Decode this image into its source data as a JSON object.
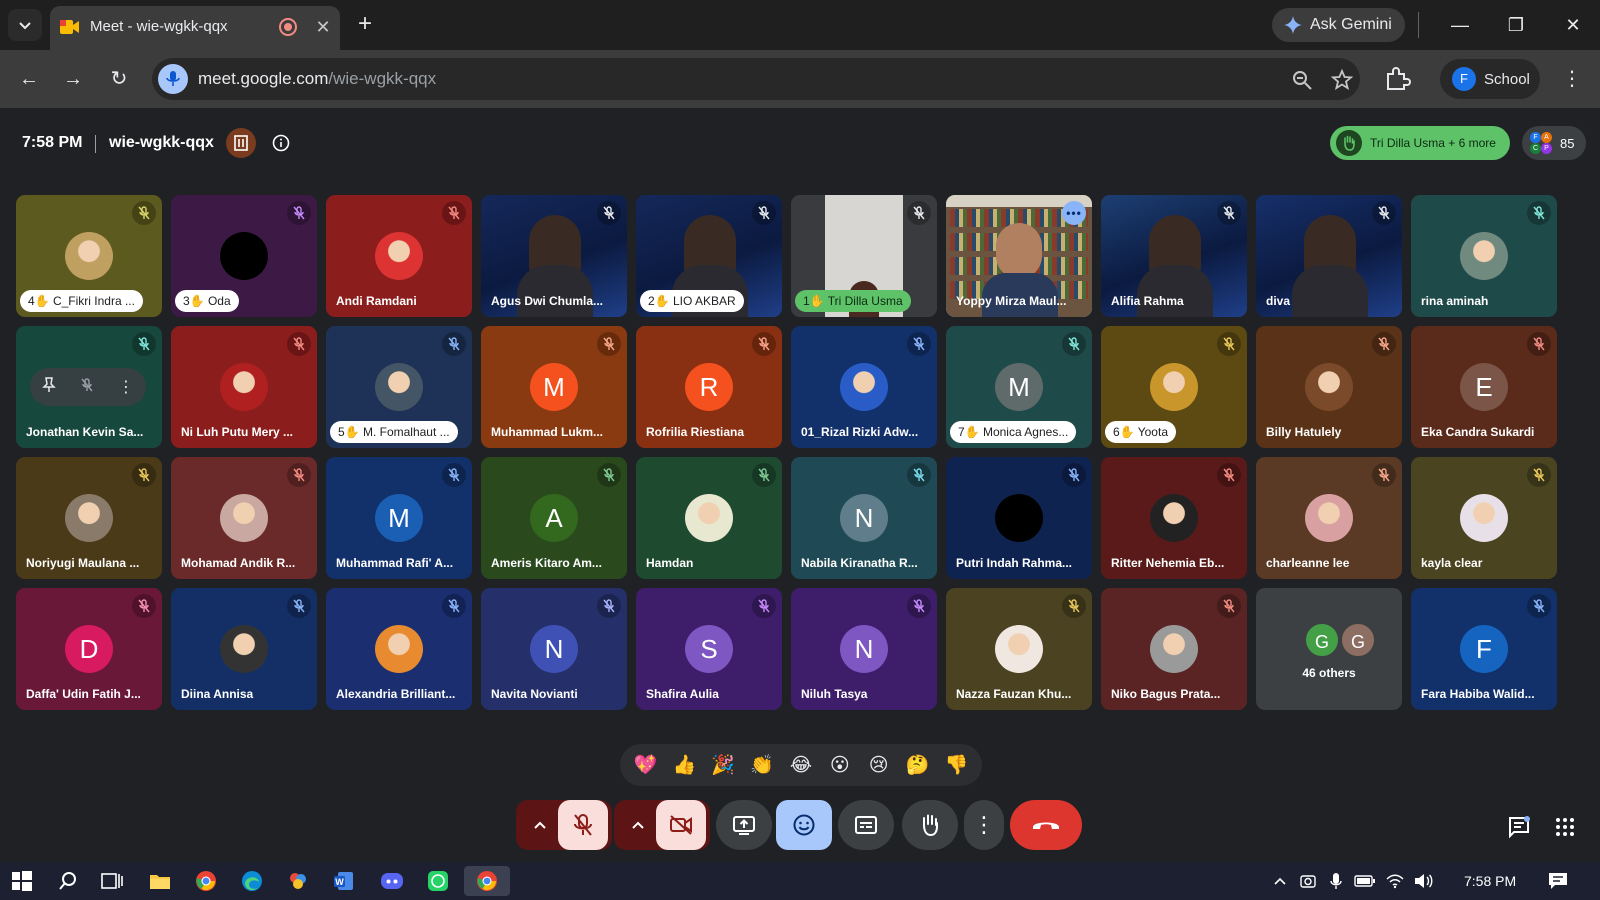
{
  "browser": {
    "tab_title": "Meet - wie-wgkk-qqx",
    "gemini_label": "Ask Gemini",
    "url_domain": "meet.google.com",
    "url_path": "/wie-wgkk-qqx",
    "profile_initial": "F",
    "profile_label": "School"
  },
  "meet": {
    "time": "7:58 PM",
    "meeting_code": "wie-wgkk-qqx",
    "hands_raised": "Tri Dilla Usma + 6 more",
    "participant_count": "85",
    "people_initials": [
      "F",
      "A",
      "C",
      "P"
    ]
  },
  "tiles": [
    {
      "name": "C_Fikri Indra ...",
      "hand": "4",
      "bg": "#5c5a1e",
      "type": "photo",
      "avatar_color": "#c0a060",
      "mute_color": "#d9d56b"
    },
    {
      "name": "Oda",
      "hand": "3",
      "bg": "#3d1a46",
      "type": "black",
      "mute_color": "#c58af9"
    },
    {
      "name": "Andi Ramdani",
      "bg": "#8c1d1d",
      "type": "photo",
      "avatar_color": "#d33",
      "mute_color": "#f28b82"
    },
    {
      "name": "Agus Dwi Chumla...",
      "bg": "#15285a",
      "type": "video",
      "mute_color": "#e8eaed"
    },
    {
      "name": "LIO AKBAR",
      "hand": "2",
      "bg": "#15285a",
      "type": "video",
      "mute_color": "#e8eaed"
    },
    {
      "name": "Tri Dilla Usma",
      "hand": "1",
      "green": true,
      "bg": "#3a3b3e",
      "type": "video-light",
      "mute_color": "#e8eaed"
    },
    {
      "name": "Yoppy Mirza Maul...",
      "bg": "#4a3826",
      "type": "video-shelf",
      "active": true,
      "more": true
    },
    {
      "name": "Alifia Rahma",
      "bg": "#1d3f73",
      "type": "video",
      "mute_color": "#e8eaed"
    },
    {
      "name": "diva",
      "bg": "#17306a",
      "type": "video",
      "mute_color": "#e8eaed"
    },
    {
      "name": "rina aminah",
      "bg": "#1f4a4a",
      "type": "photo",
      "avatar_color": "#708a80",
      "mute_color": "#81e6d9"
    },
    {
      "name": "Jonathan Kevin Sa...",
      "bg": "#17483d",
      "type": "hover",
      "mute_color": "#81e6d9"
    },
    {
      "name": "Ni Luh Putu Mery ...",
      "bg": "#8c1d1d",
      "type": "photo",
      "avatar_color": "#b02020",
      "mute_color": "#f28b82"
    },
    {
      "name": "M. Fomalhaut ...",
      "hand": "5",
      "bg": "#1d3256",
      "type": "photo",
      "avatar_color": "#445566",
      "mute_color": "#8ab4f8"
    },
    {
      "name": "Muhammad Lukm...",
      "bg": "#8a3a10",
      "type": "letter",
      "letter": "M",
      "avatar_color": "#f4511e",
      "mute_color": "#f6a68a"
    },
    {
      "name": "Rofrilia Riestiana",
      "bg": "#8a3012",
      "type": "letter",
      "letter": "R",
      "avatar_color": "#f4511e",
      "mute_color": "#f6a68a"
    },
    {
      "name": "01_Rizal Rizki Adw...",
      "bg": "#12306a",
      "type": "photo",
      "avatar_color": "#2a5cc8",
      "mute_color": "#8ab4f8"
    },
    {
      "name": "Monica Agnes...",
      "hand": "7",
      "bg": "#1f4a4a",
      "type": "letter",
      "letter": "M",
      "avatar_color": "#5f6b6b",
      "mute_color": "#81e6d9"
    },
    {
      "name": "Yoota",
      "hand": "6",
      "bg": "#5c4a12",
      "type": "photo",
      "avatar_color": "#c8962a",
      "mute_color": "#e8c85a"
    },
    {
      "name": "Billy Hatulely",
      "bg": "#5a3218",
      "type": "photo",
      "avatar_color": "#7a4a2a",
      "mute_color": "#f6a68a"
    },
    {
      "name": "Eka Candra Sukardi",
      "bg": "#5a2a1a",
      "type": "letter",
      "letter": "E",
      "avatar_color": "#7a5548",
      "mute_color": "#f28b82"
    },
    {
      "name": "Noriyugi Maulana ...",
      "bg": "#4a3a18",
      "type": "photo",
      "avatar_color": "#8a7a6a",
      "mute_color": "#e8c85a"
    },
    {
      "name": "Mohamad Andik R...",
      "bg": "#6b2a2a",
      "type": "photo",
      "avatar_color": "#c8a8a0",
      "mute_color": "#f28b82"
    },
    {
      "name": "Muhammad Rafi' A...",
      "bg": "#12306a",
      "type": "letter",
      "letter": "M",
      "avatar_color": "#1a5fb4",
      "mute_color": "#8ab4f8"
    },
    {
      "name": "Ameris Kitaro Am...",
      "bg": "#2a4a1e",
      "type": "letter",
      "letter": "A",
      "avatar_color": "#33691e",
      "mute_color": "#81c995"
    },
    {
      "name": "Hamdan",
      "bg": "#1e4a30",
      "type": "photo",
      "avatar_color": "#e8e8d0",
      "mute_color": "#81c995"
    },
    {
      "name": "Nabila Kiranatha R...",
      "bg": "#1f4a55",
      "type": "letter",
      "letter": "N",
      "avatar_color": "#607d8b",
      "mute_color": "#78d9ec"
    },
    {
      "name": "Putri Indah Rahma...",
      "bg": "#0f2350",
      "type": "black",
      "mute_color": "#8ab4f8"
    },
    {
      "name": "Ritter Nehemia Eb...",
      "bg": "#5a1a1a",
      "type": "photo",
      "avatar_color": "#222",
      "mute_color": "#f28b82"
    },
    {
      "name": "charleanne lee",
      "bg": "#5a3a24",
      "type": "photo",
      "avatar_color": "#d8a0a0",
      "mute_color": "#f6a68a"
    },
    {
      "name": "kayla clear",
      "bg": "#4a4420",
      "type": "photo",
      "avatar_color": "#e8e0e8",
      "mute_color": "#e8c85a"
    },
    {
      "name": "Daffa' Udin Fatih J...",
      "bg": "#6a1838",
      "type": "letter",
      "letter": "D",
      "avatar_color": "#d81b60",
      "mute_color": "#f48fb1"
    },
    {
      "name": "Diina Annisa",
      "bg": "#142f66",
      "type": "photo",
      "avatar_color": "#333",
      "mute_color": "#8ab4f8"
    },
    {
      "name": "Alexandria Brilliant...",
      "bg": "#1a2e70",
      "type": "photo",
      "avatar_color": "#e88a30",
      "mute_color": "#8ab4f8"
    },
    {
      "name": "Navita Novianti",
      "bg": "#25306a",
      "type": "letter",
      "letter": "N",
      "avatar_color": "#3f51b5",
      "mute_color": "#aab4f8"
    },
    {
      "name": "Shafira Aulia",
      "bg": "#3e1e6a",
      "type": "letter",
      "letter": "S",
      "avatar_color": "#7e57c2",
      "mute_color": "#c58af9"
    },
    {
      "name": "Niluh Tasya",
      "bg": "#3e1e6a",
      "type": "letter",
      "letter": "N",
      "avatar_color": "#7e57c2",
      "mute_color": "#c58af9"
    },
    {
      "name": "Nazza Fauzan Khu...",
      "bg": "#4a4220",
      "type": "photo",
      "avatar_color": "#f0e8e0",
      "mute_color": "#e8c85a"
    },
    {
      "name": "Niko Bagus Prata...",
      "bg": "#5a2424",
      "type": "photo",
      "avatar_color": "#9a9a9a",
      "mute_color": "#f28b82"
    },
    {
      "name": "46 others",
      "bg": "#3c4043",
      "type": "others",
      "letters": [
        "G",
        "G"
      ]
    },
    {
      "name": "Fara Habiba Walid...",
      "bg": "#12306a",
      "type": "letter",
      "letter": "F",
      "avatar_color": "#1565c0",
      "mute_color": "#8ab4f8"
    }
  ],
  "reactions": [
    "💖",
    "👍",
    "🎉",
    "👏",
    "😂",
    "😮",
    "😢",
    "🤔",
    "👎"
  ],
  "taskbar": {
    "time": "7:58 PM"
  }
}
